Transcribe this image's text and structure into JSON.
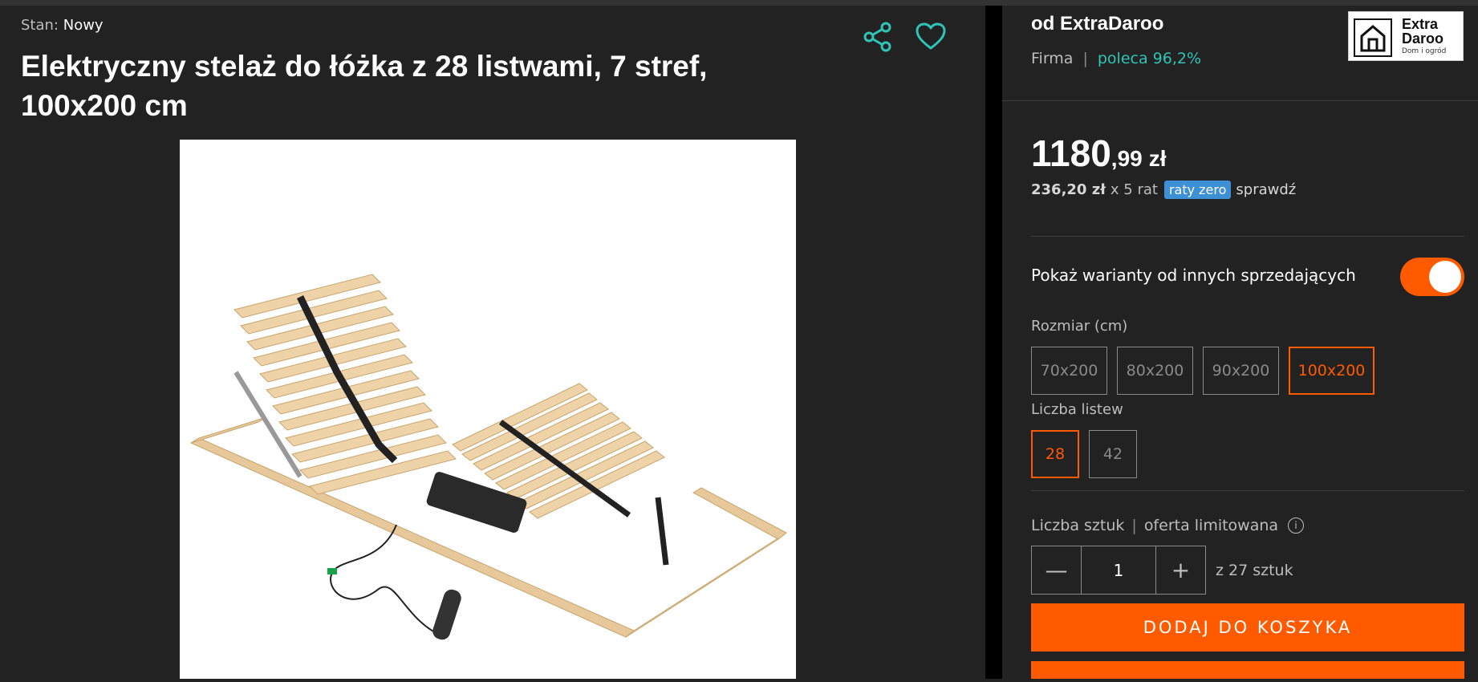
{
  "product": {
    "condition_label": "Stan:",
    "condition_value": "Nowy",
    "title": "Elektryczny stelaż do łóżka z 28 listwami, 7 stref, 100x200 cm",
    "image_alt_icon": "bed-frame-photo"
  },
  "seller": {
    "name": "od ExtraDaroo",
    "type": "Firma",
    "separator": "|",
    "recommend": "poleca 96,2%",
    "logo": {
      "line1": "Extra",
      "line2": "Daroo",
      "line3": "Dom i ogród"
    }
  },
  "price": {
    "integer": "1180",
    "decimal": ",99",
    "currency": "zł"
  },
  "installment": {
    "amount": "236,20 zł",
    "count": "x 5 rat",
    "badge": "raty zero",
    "check": "sprawdź"
  },
  "variants": {
    "toggle_label": "Pokaż warianty od innych sprzedających",
    "toggle_on": true
  },
  "size": {
    "label": "Rozmiar (cm)",
    "options": [
      "70x200",
      "80x200",
      "90x200",
      "100x200"
    ],
    "selected": "100x200"
  },
  "slats": {
    "label": "Liczba listew",
    "options": [
      "28",
      "42"
    ],
    "selected": "28"
  },
  "quantity": {
    "label": "Liczba sztuk",
    "separator": "|",
    "note": "oferta limitowana",
    "value": "1",
    "minus": "—",
    "plus": "+",
    "available": "z 27 sztuk"
  },
  "actions": {
    "add_to_cart": "DODAJ DO KOSZYKA"
  },
  "colors": {
    "accent": "#ff5a00",
    "teal": "#2ec4b6",
    "badge": "#3d8fd6",
    "background": "#222222"
  }
}
